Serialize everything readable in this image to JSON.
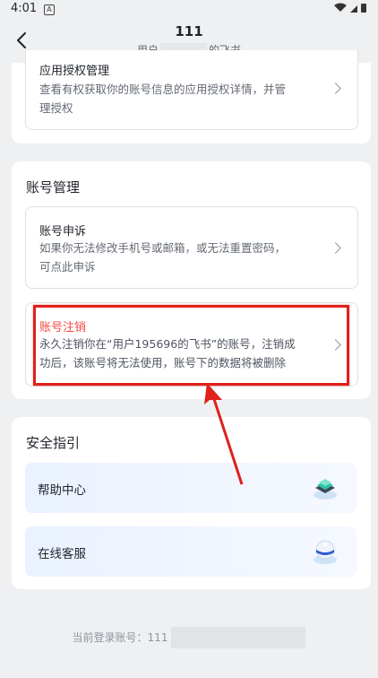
{
  "status_bar": {
    "time": "4:01",
    "notification": "A",
    "icons": "▾◢▮"
  },
  "header": {
    "title": "111",
    "subtitle_prefix": "用户",
    "subtitle_suffix": "的飞书"
  },
  "app_auth": {
    "title": "应用授权管理",
    "desc_line1": "查看有权获取你的账号信息的应用授权详情，并管",
    "desc_line2": "理授权"
  },
  "account_mgmt": {
    "section_title": "账号管理",
    "appeal": {
      "title": "账号申诉",
      "desc_line1": "如果你无法修改手机号或邮箱，或无法重置密码，",
      "desc_line2": "可点此申诉"
    },
    "deactivate": {
      "title": "账号注销",
      "desc_line1": "永久注销你在“用户195696的飞书”的账号，注销成",
      "desc_line2": "功后，该账号将无法使用，账号下的数据将被删除"
    }
  },
  "safety_guide": {
    "section_title": "安全指引",
    "items": [
      {
        "label": "帮助中心",
        "icon": "help-center-icon"
      },
      {
        "label": "在线客服",
        "icon": "customer-service-icon"
      }
    ]
  },
  "footer": {
    "current_account_label": "当前登录账号：111"
  },
  "colors": {
    "highlight": "#e0201a",
    "deactivate_title": "#f54a45",
    "background": "#eff0f2"
  }
}
